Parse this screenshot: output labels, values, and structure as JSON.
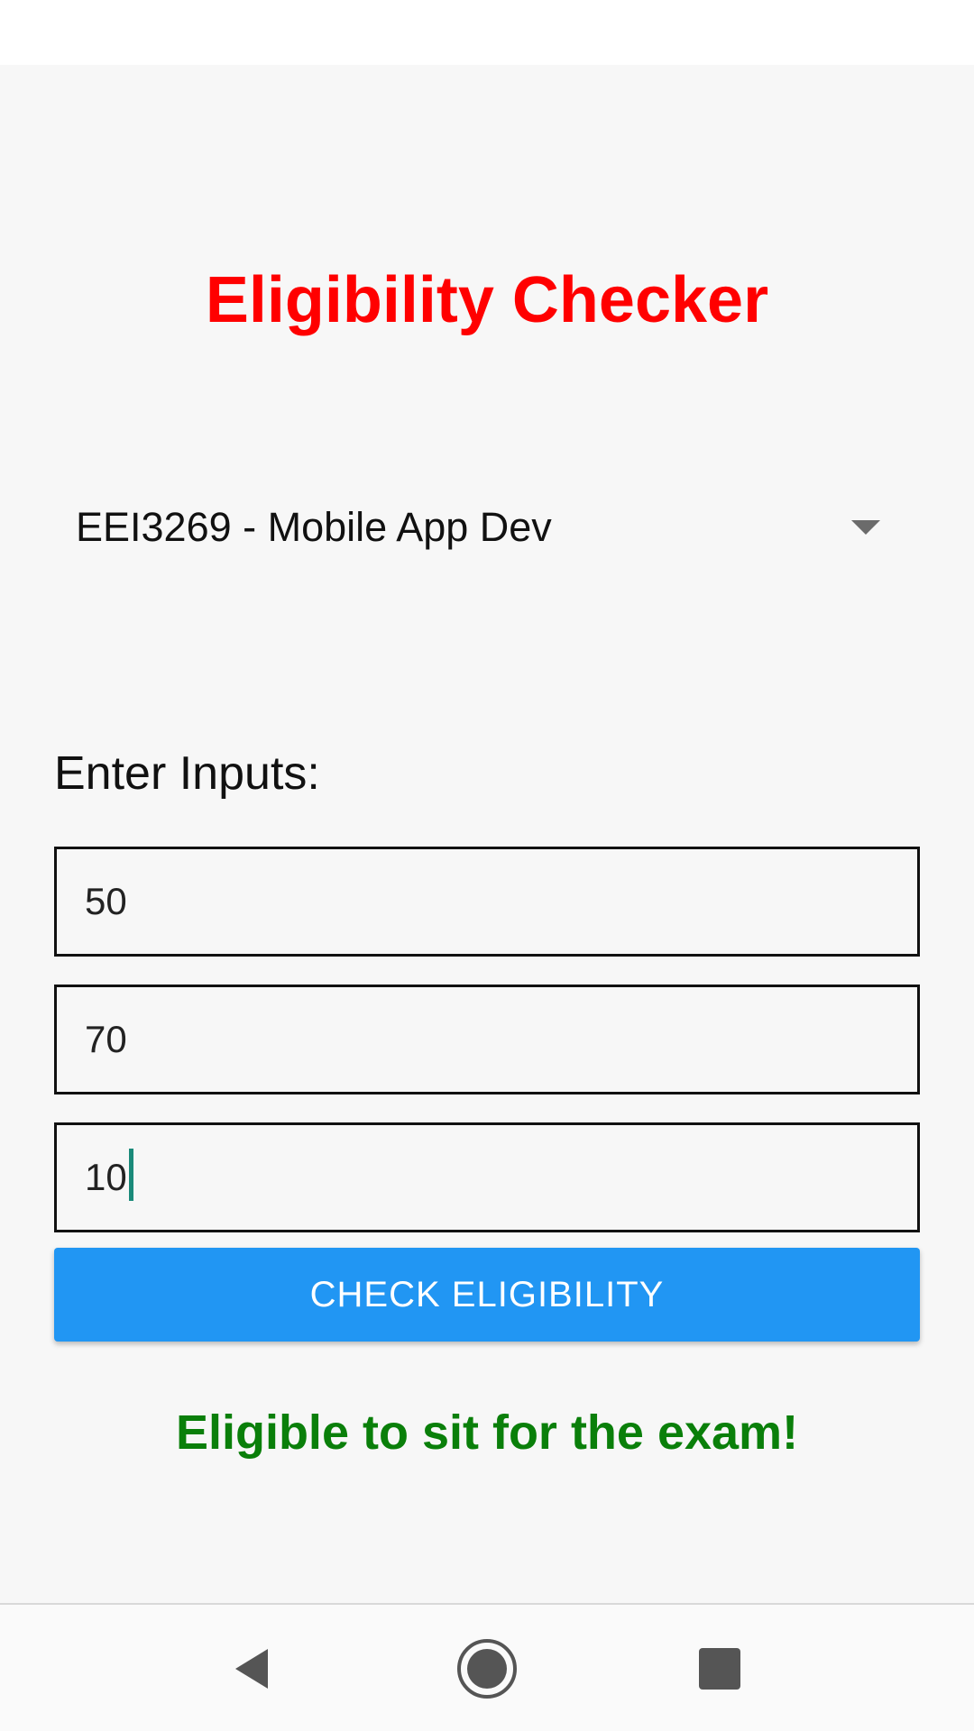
{
  "app": {
    "title": "Eligibility Checker"
  },
  "spinner": {
    "selected": "EEI3269 - Mobile App Dev"
  },
  "form": {
    "label": "Enter Inputs:",
    "inputs": [
      {
        "value": "50"
      },
      {
        "value": "70"
      },
      {
        "value": "10"
      }
    ],
    "button_label": "CHECK ELIGIBILITY"
  },
  "result": {
    "message": "Eligible to sit for the exam!"
  },
  "colors": {
    "title": "#ff0000",
    "button": "#2196f3",
    "result": "#0a7f0a",
    "background": "#f7f7f7"
  },
  "navigation": {
    "icons": [
      "back-icon",
      "home-icon",
      "recents-icon"
    ]
  }
}
